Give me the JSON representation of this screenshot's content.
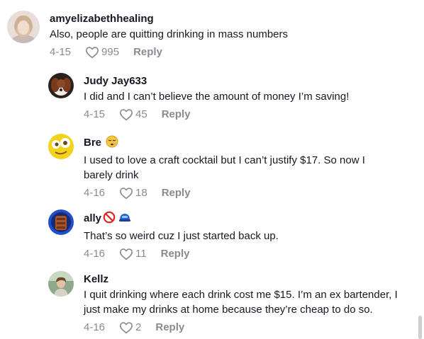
{
  "comments": [
    {
      "username": "amyelizabethhealing",
      "text": "Also, people are quitting drinking in mass numbers",
      "date": "4-15",
      "likes": "995",
      "reply_label": "Reply"
    },
    {
      "username": "Judy Jay633",
      "text": "I did and I can’t believe the amount of money I’m saving!",
      "date": "4-15",
      "likes": "45",
      "reply_label": "Reply"
    },
    {
      "username": "Bre",
      "username_emoji": "sleepy-face-emoji",
      "text": "I used to love a craft cocktail but I can’t justify $17. So now I barely drink",
      "date": "4-16",
      "likes": "18",
      "reply_label": "Reply"
    },
    {
      "username": "ally",
      "username_emoji": [
        "prohibited-emoji",
        "blue-helmet-emoji"
      ],
      "text": "That’s so weird cuz I just started back up.",
      "date": "4-16",
      "likes": "11",
      "reply_label": "Reply"
    },
    {
      "username": "Kellz",
      "text": "I quit drinking where each drink cost me $15. I’m an ex bartender, I just make my drinks at home because they’re cheap to do so.",
      "date": "4-16",
      "likes": "2",
      "reply_label": "Reply"
    }
  ],
  "icons": {
    "like": "heart-outline-icon"
  },
  "colors": {
    "text": "#161823",
    "meta": "#8a8b91"
  }
}
